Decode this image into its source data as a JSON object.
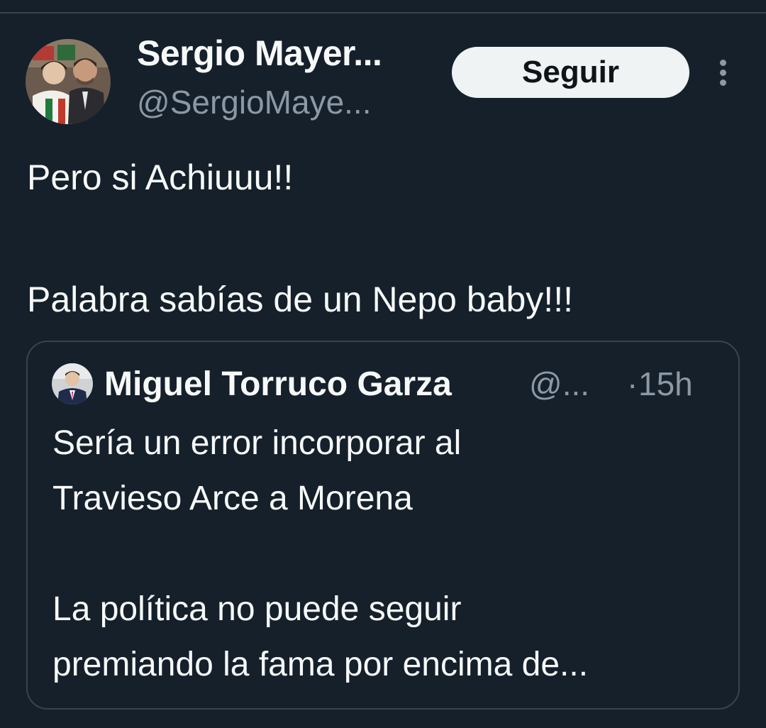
{
  "tweet": {
    "author": {
      "display_name": "Sergio Mayer...",
      "handle": "@SergioMaye...",
      "avatar": "profile-photo"
    },
    "follow_label": "Seguir",
    "more_icon": "more-vertical-icon",
    "text_lines": [
      "Pero si Achiuuu!!",
      "Palabra sabías de un Nepo baby!!!"
    ]
  },
  "quoted_tweet": {
    "author": {
      "display_name": "Miguel Torruco Garza",
      "handle": "@...",
      "avatar": "profile-photo"
    },
    "separator": "·",
    "time": "15h",
    "text_lines": [
      "Sería un error incorporar al",
      "Travieso Arce a Morena",
      "La política no puede seguir",
      "premiando la fama por encima de..."
    ]
  },
  "colors": {
    "background": "#15202b",
    "primary_text": "#f7f9f9",
    "secondary_text": "#8b98a5",
    "border": "#38444d",
    "button_bg": "#eff3f4",
    "button_text": "#0f1419"
  }
}
